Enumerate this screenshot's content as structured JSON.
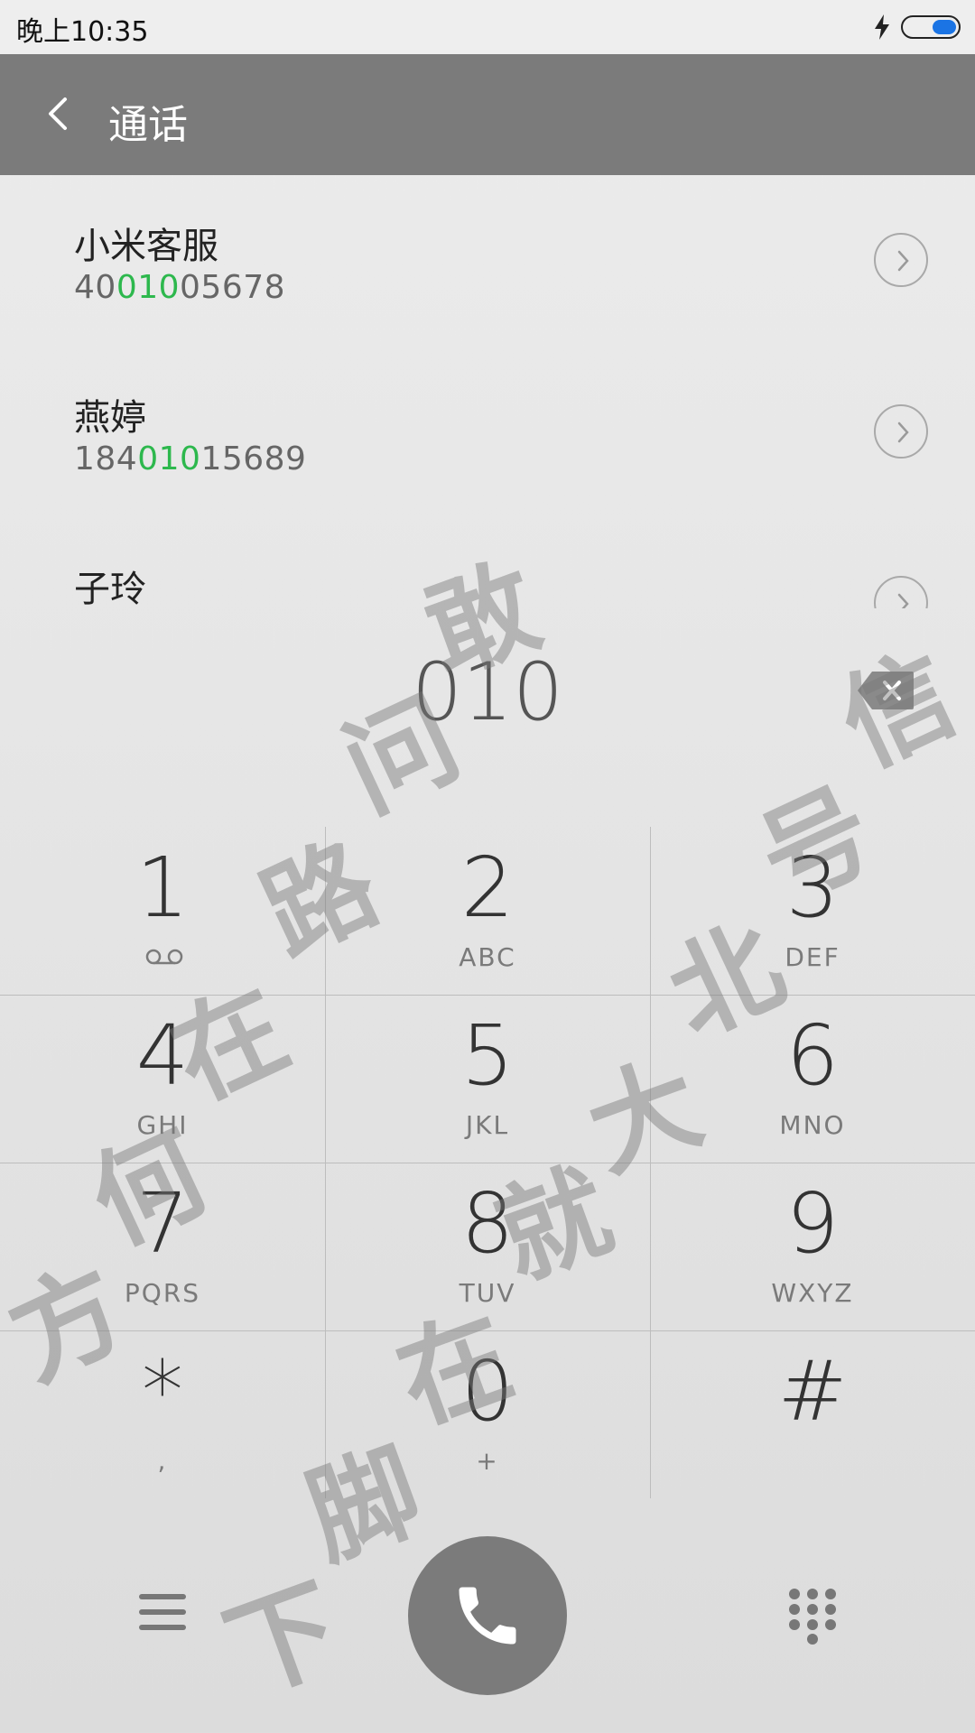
{
  "status_bar": {
    "time": "晚上10:35"
  },
  "header": {
    "title": "通话"
  },
  "contacts": [
    {
      "name": "小米客服",
      "number_parts": [
        "40",
        "010",
        "05678"
      ]
    },
    {
      "name": "燕婷",
      "number_parts": [
        "184",
        "010",
        "15689"
      ]
    },
    {
      "name": "子玲"
    }
  ],
  "dial": {
    "input": "010"
  },
  "keypad": {
    "keys": [
      {
        "digit": "1",
        "letters": ""
      },
      {
        "digit": "2",
        "letters": "ABC"
      },
      {
        "digit": "3",
        "letters": "DEF"
      },
      {
        "digit": "4",
        "letters": "GHI"
      },
      {
        "digit": "5",
        "letters": "JKL"
      },
      {
        "digit": "6",
        "letters": "MNO"
      },
      {
        "digit": "7",
        "letters": "PQRS"
      },
      {
        "digit": "8",
        "letters": "TUV"
      },
      {
        "digit": "9",
        "letters": "WXYZ"
      },
      {
        "digit": "*",
        "letters": ","
      },
      {
        "digit": "0",
        "letters": "+"
      },
      {
        "digit": "#",
        "letters": ""
      }
    ]
  },
  "watermark": [
    "敢",
    "问",
    "路",
    "在",
    "何",
    "方",
    "就",
    "在",
    "脚",
    "下",
    "信",
    "号",
    "北",
    "大"
  ],
  "colors": {
    "header_bg": "#7b7b7b",
    "highlight": "#2db84d",
    "call_button": "#7b7b7b"
  },
  "icons": {
    "back": "chevron-left-icon",
    "detail": "chevron-right-icon",
    "backspace": "backspace-icon",
    "voicemail": "voicemail-icon",
    "menu": "menu-icon",
    "call": "phone-icon",
    "keypad_toggle": "dialpad-icon"
  }
}
